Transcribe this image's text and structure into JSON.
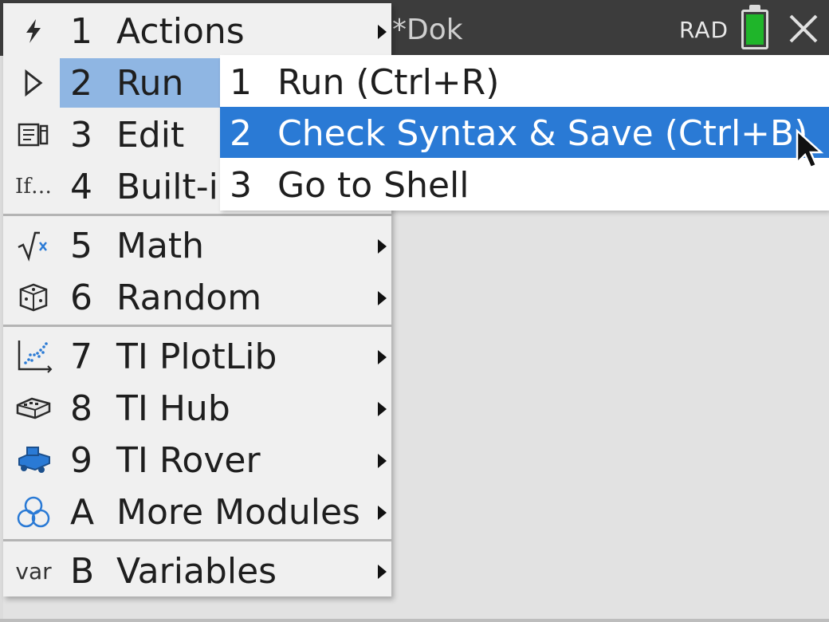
{
  "titlebar": {
    "doc_title": "*Dok",
    "angle_mode": "RAD",
    "battery_color": "#1fb52a"
  },
  "menu": {
    "items": [
      {
        "icon": "lightning-icon",
        "key": "1",
        "label": "Actions",
        "submenu": true
      },
      {
        "icon": "run-triangle-icon",
        "key": "2",
        "label": "Run",
        "submenu": true,
        "state": "open"
      },
      {
        "icon": "edit-document-icon",
        "key": "3",
        "label": "Edit",
        "submenu": true
      },
      {
        "icon": "if-builtins-icon",
        "icon_text": "If…",
        "key": "4",
        "label": "Built-ins",
        "submenu": true
      },
      {
        "icon": "sqrt-math-icon",
        "key": "5",
        "label": "Math",
        "submenu": true
      },
      {
        "icon": "dice-icon",
        "key": "6",
        "label": "Random",
        "submenu": true
      },
      {
        "icon": "scatter-plot-icon",
        "key": "7",
        "label": "TI PlotLib",
        "submenu": true
      },
      {
        "icon": "hub-device-icon",
        "key": "8",
        "label": "TI Hub",
        "submenu": true
      },
      {
        "icon": "rover-icon",
        "key": "9",
        "label": "TI Rover",
        "submenu": true
      },
      {
        "icon": "three-circles-icon",
        "key": "A",
        "label": "More Modules",
        "submenu": true
      },
      {
        "icon": "var-icon",
        "icon_text": "var",
        "key": "B",
        "label": "Variables",
        "submenu": true
      }
    ]
  },
  "submenu": {
    "items": [
      {
        "key": "1",
        "label": "Run (Ctrl+R)"
      },
      {
        "key": "2",
        "label": "Check Syntax & Save (Ctrl+B)",
        "selected": true
      },
      {
        "key": "3",
        "label": "Go to Shell"
      }
    ]
  },
  "colors": {
    "menu_bg": "#f0f0f0",
    "open_item_highlight": "#8fb6e3",
    "selected_item": "#2a7ad5",
    "titlebar_bg": "#3c3c3c"
  }
}
